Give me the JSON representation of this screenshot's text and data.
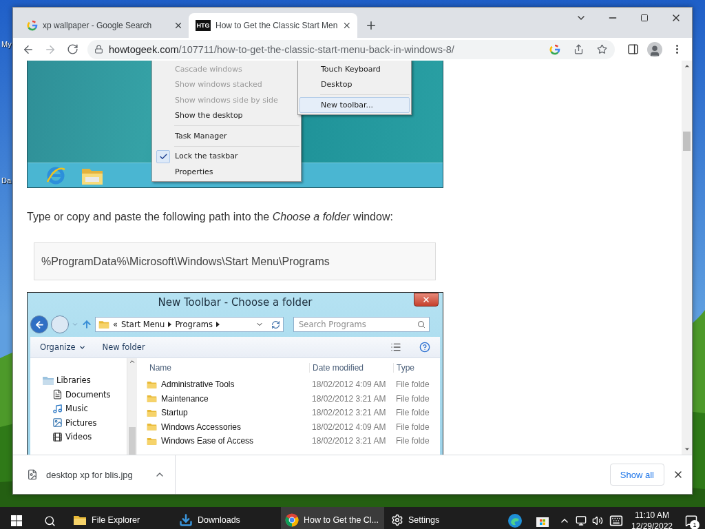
{
  "desktop": {
    "icon_labels": [
      "My",
      "Da"
    ]
  },
  "browser": {
    "tabs": [
      {
        "title": "xp wallpaper - Google Search",
        "selected": false
      },
      {
        "title": "How to Get the Classic Start Men",
        "favicon_text": "HTG",
        "selected": true
      }
    ],
    "address": {
      "host": "howtogeek.com",
      "path": "/107711/how-to-get-the-classic-start-menu-back-in-windows-8/"
    }
  },
  "article": [
    {
      "kind": "screenshot_menu",
      "menu_groups": [
        [
          {
            "label": "Cascade windows",
            "disabled": true,
            "checked": false
          },
          {
            "label": "Show windows stacked",
            "disabled": true,
            "checked": false
          },
          {
            "label": "Show windows side by side",
            "disabled": true,
            "checked": false
          },
          {
            "label": "Show the desktop",
            "disabled": false,
            "checked": false
          }
        ],
        [
          {
            "label": "Task Manager",
            "disabled": false,
            "checked": false
          }
        ],
        [
          {
            "label": "Lock the taskbar",
            "disabled": false,
            "checked": true
          },
          {
            "label": "Properties",
            "disabled": false,
            "checked": false
          }
        ]
      ],
      "submenu_groups": [
        [
          {
            "label": "Touch Keyboard",
            "selected": false
          },
          {
            "label": "Desktop",
            "selected": false
          }
        ],
        [
          {
            "label": "New toolbar...",
            "selected": true
          }
        ]
      ]
    },
    {
      "kind": "paragraph",
      "text": "Type or copy and paste the following path into the *Choose a folder* window:"
    },
    {
      "kind": "code",
      "text": "%ProgramData%\\Microsoft\\Windows\\Start Menu\\Programs"
    },
    {
      "kind": "screenshot_dialog",
      "title": "New Toolbar - Choose a folder",
      "breadcrumb_lead": "«",
      "breadcrumb": [
        "Start Menu",
        "Programs"
      ],
      "search_placeholder": "Search Programs",
      "commands": [
        {
          "label": "Organize",
          "dropdown": true
        },
        {
          "label": "New folder",
          "dropdown": false
        }
      ],
      "nav": [
        {
          "label": "Libraries",
          "children": [
            {
              "label": "Documents"
            },
            {
              "label": "Music"
            },
            {
              "label": "Pictures"
            },
            {
              "label": "Videos"
            }
          ]
        }
      ],
      "columns": [
        "Name",
        "Date modified",
        "Type"
      ],
      "rows": [
        {
          "name": "Administrative Tools",
          "date": "18/02/2012 4:09 AM",
          "type": "File folde"
        },
        {
          "name": "Maintenance",
          "date": "18/02/2012 3:21 AM",
          "type": "File folde"
        },
        {
          "name": "Startup",
          "date": "18/02/2012 3:21 AM",
          "type": "File folde"
        },
        {
          "name": "Windows Accessories",
          "date": "18/02/2012 4:09 AM",
          "type": "File folde"
        },
        {
          "name": "Windows Ease of Access",
          "date": "18/02/2012 3:21 AM",
          "type": "File folde"
        }
      ]
    }
  ],
  "downloads": {
    "file": "desktop xp for blis.jpg",
    "show_all": "Show all"
  },
  "taskbar": {
    "apps": [
      {
        "label": "File Explorer",
        "active": false
      },
      {
        "label": "Downloads",
        "active": false
      },
      {
        "label": "How to Get the Cl...",
        "active": true
      },
      {
        "label": "Settings",
        "active": false
      }
    ],
    "time": "11:10 AM",
    "date": "12/29/2022",
    "notification_count": "1"
  }
}
